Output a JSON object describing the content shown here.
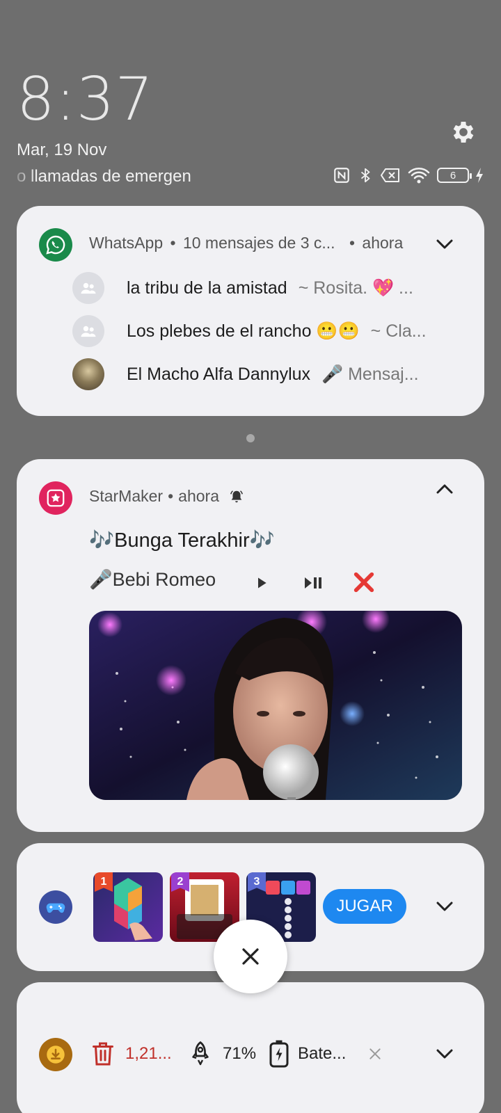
{
  "status": {
    "time": "8:37",
    "date": "Mar, 19 Nov",
    "carrier": "o llamadas de emergen",
    "battery_level": "6",
    "icons": [
      "nfc-icon",
      "bluetooth-icon",
      "no-sim-icon",
      "wifi-icon",
      "battery-icon",
      "charging-icon"
    ],
    "settings_icon": "gear-icon"
  },
  "whatsapp": {
    "app_name": "WhatsApp",
    "summary": "10 mensajes de 3 c...",
    "time": "ahora",
    "separator": "•",
    "accent": "#1a8a4a",
    "chats": [
      {
        "name": "la tribu de la amistad",
        "message": "~ Rosita. 💖 ..."
      },
      {
        "name": "Los plebes de el rancho 😬😬",
        "message": "~ Cla..."
      },
      {
        "name": "El Macho Alfa Dannylux",
        "message": "🎤 Mensaj..."
      }
    ]
  },
  "starmaker": {
    "app_name": "StarMaker",
    "time": "ahora",
    "separator": "•",
    "accent": "#e0245e",
    "song_title": "🎶Bunga Terakhir🎶",
    "artist": "🎤Bebi Romeo",
    "controls": [
      "play-icon",
      "play-pause-icon",
      "close-red-icon"
    ]
  },
  "games": {
    "thumbs": [
      {
        "rank": "1",
        "name": "hexa-puzzle"
      },
      {
        "rank": "2",
        "name": "blackjack-21"
      },
      {
        "rank": "3",
        "name": "block-shooter"
      }
    ],
    "play_label": "JUGAR",
    "accent": "#1e88f0"
  },
  "utility": {
    "junk_size": "1,21...",
    "boost_percent": "71%",
    "battery_label": "Bate..."
  }
}
